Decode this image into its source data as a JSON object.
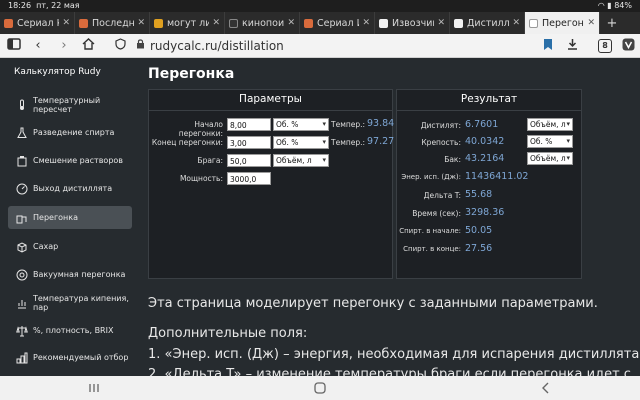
{
  "status": {
    "time": "18:26",
    "date": "пт, 22 мая",
    "battery": "84%"
  },
  "tabs": [
    {
      "label": "Сериал Ку",
      "color": "#d96b3c"
    },
    {
      "label": "Последние",
      "color": "#d96b3c"
    },
    {
      "label": "могут ли н",
      "color": "#e0a020"
    },
    {
      "label": "кинопоиск",
      "color": "#333333"
    },
    {
      "label": "Сериал Изв",
      "color": "#d96b3c"
    },
    {
      "label": "Извозчик (",
      "color": "#f2f2f2"
    },
    {
      "label": "Дистилляц",
      "color": "#f2f2f2"
    },
    {
      "label": "Перегонк",
      "color": "#ffffff"
    }
  ],
  "address": {
    "url": "rudycalc.ru/distillation",
    "tab_count": "8"
  },
  "sidebar": {
    "brand": "Калькулятор Rudy",
    "items": [
      {
        "label": "Температурный пересчет",
        "icon": "thermometer-icon"
      },
      {
        "label": "Разведение спирта",
        "icon": "flask-icon"
      },
      {
        "label": "Смешение растворов",
        "icon": "mixing-icon"
      },
      {
        "label": "Выход дистиллята",
        "icon": "gauge-icon"
      },
      {
        "label": "Перегонка",
        "icon": "still-icon"
      },
      {
        "label": "Сахар",
        "icon": "sugar-cube-icon"
      },
      {
        "label": "Вакуумная перегонка",
        "icon": "vacuum-icon"
      },
      {
        "label": "Температура кипения, пар",
        "icon": "steam-icon"
      },
      {
        "label": "%, плотность, BRIX",
        "icon": "scales-icon"
      },
      {
        "label": "Рекомендуемый отбор",
        "icon": "selection-icon"
      }
    ]
  },
  "page": {
    "title": "Перегонка"
  },
  "params": {
    "title": "Параметры",
    "start": {
      "label": "Начало перегонки:",
      "value": "8,00",
      "unit": "Об. %",
      "temp_label": "Темпер.:",
      "temp_value": "93.84"
    },
    "end": {
      "label": "Конец перегонки:",
      "value": "3,00",
      "unit": "Об. %",
      "temp_label": "Темпер.:",
      "temp_value": "97.27"
    },
    "brew": {
      "label": "Брага:",
      "value": "50,0",
      "unit": "Объём, л"
    },
    "power": {
      "label": "Мощность:",
      "value": "3000,0"
    }
  },
  "result": {
    "title": "Результат",
    "rows": [
      {
        "label": "Дистилят:",
        "value": "6.7601",
        "unit": "Объём, л"
      },
      {
        "label": "Крепость:",
        "value": "40.0342",
        "unit": "Об. %"
      },
      {
        "label": "Бак:",
        "value": "43.2164",
        "unit": "Объём, л"
      },
      {
        "label": "Энер. исп. (Дж):",
        "value": "11436411.02",
        "unit": ""
      },
      {
        "label": "Дельта T:",
        "value": "55.68",
        "unit": ""
      },
      {
        "label": "Время (сек):",
        "value": "3298.36",
        "unit": ""
      },
      {
        "label": "Спирт. в начале:",
        "value": "50.05",
        "unit": ""
      },
      {
        "label": "Спирт. в конце:",
        "value": "27.56",
        "unit": ""
      }
    ]
  },
  "article": {
    "intro": "Эта страница моделирует перегонку с заданными параметрами.",
    "extra_title": "Дополнительные поля:",
    "item1": "1. «Энер. исп. (Дж) – энергия, необходимая для испарения дистиллята",
    "item2": "2. «Дельта T» – изменение температуры браги если перегонка идет с"
  }
}
